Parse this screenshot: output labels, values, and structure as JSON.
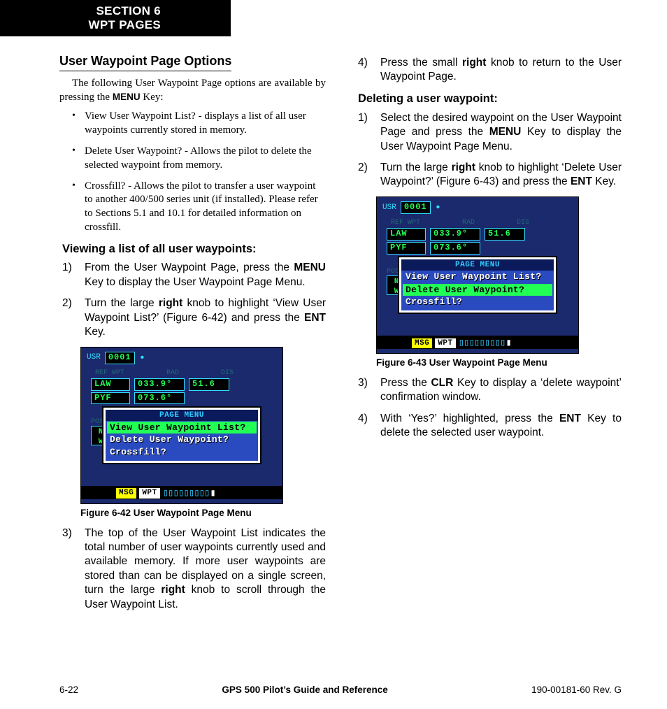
{
  "header": {
    "line1": "SECTION 6",
    "line2": "WPT PAGES"
  },
  "col1": {
    "title": "User Waypoint Page Options",
    "intro_pre": "The following User Waypoint Page options are available by pressing the ",
    "intro_key": "MENU",
    "intro_post": " Key:",
    "bullets": [
      "View User Waypoint List? - displays a list of all user waypoints currently stored in memory.",
      "Delete User Waypoint? - Allows the pilot to delete the selected waypoint from memory.",
      "Crossfill? - Allows the pilot to transfer a user waypoint to another 400/500 series unit (if installed).  Please refer to Sections 5.1 and 10.1 for detailed information on crossfill."
    ],
    "subhead1": "Viewing a list of all user waypoints:",
    "step1": {
      "num": "1)",
      "pre": "From the User Waypoint Page, press the ",
      "k1": "MENU",
      "post": " Key to display the User Waypoint Page Menu."
    },
    "step2": {
      "num": "2)",
      "pre": "Turn the large ",
      "k1": "right",
      "mid": " knob to highlight ‘View User Waypoint List?’ (Figure 6-42) and press the ",
      "k2": "ENT",
      "post": " Key."
    },
    "figcap": "Figure 6-42  User Waypoint Page Menu",
    "step3": {
      "num": "3)",
      "pre": "The top of the User Waypoint List indicates the total number of user waypoints currently used and available memory.  If more user waypoints are stored than can be displayed on a single screen, turn the large ",
      "k1": "right",
      "post": " knob to scroll through the User Waypoint List."
    }
  },
  "col2": {
    "step4": {
      "num": "4)",
      "pre": "Press the small ",
      "k1": "right",
      "post": " knob to return to the User Waypoint Page."
    },
    "subhead2": "Deleting a user waypoint:",
    "d1": {
      "num": "1)",
      "pre": "Select the desired waypoint on the User Waypoint Page and press the ",
      "k1": "MENU",
      "post": " Key to display the User Waypoint Page Menu."
    },
    "d2": {
      "num": "2)",
      "pre": "Turn the large ",
      "k1": "right",
      "mid": " knob to highlight ‘Delete User Waypoint?’ (Figure 6-43) and press the ",
      "k2": "ENT",
      "post": " Key."
    },
    "figcap": "Figure 6-43  User Waypoint Page Menu",
    "d3": {
      "num": "3)",
      "pre": "Press the ",
      "k1": "CLR",
      "post": " Key to display a ‘delete waypoint’ confirmation window."
    },
    "d4": {
      "num": "4)",
      "pre": "With ‘Yes?’ highlighted, press the ",
      "k1": "ENT",
      "post": " Key to delete the selected user waypoint."
    }
  },
  "gps1": {
    "usr": "USR",
    "id": "0001",
    "lbl_ref": "REF WPT",
    "lbl_rad": "RAD",
    "lbl_dis": "DIS",
    "r1c1": "LAW",
    "r1c2": "033.9°",
    "r1c3": "51.6",
    "r2c1": "PYF",
    "r2c2": "073.6°",
    "pos": "POS",
    "n": "N",
    "w": "W",
    "menu_title": "PAGE MENU",
    "m1": "View User Waypoint List?",
    "m2": "Delete User Waypoint?",
    "m3": "Crossfill?",
    "msg": "MSG",
    "wpt": "WPT",
    "bars": "▯▯▯▯▯▯▯▯▯"
  },
  "gps2": {
    "usr": "USR",
    "id": "0001",
    "lbl_ref": "REF WPT",
    "lbl_rad": "RAD",
    "lbl_dis": "DIS",
    "r1c1": "LAW",
    "r1c2": "033.9°",
    "r1c3": "51.6",
    "r2c1": "PYF",
    "r2c2": "073.6°",
    "pos": "POS",
    "n": "N",
    "w": "W",
    "menu_title": "PAGE MENU",
    "m1": "View User Waypoint List?",
    "m2": "Delete User Waypoint?",
    "m3": "Crossfill?",
    "msg": "MSG",
    "wpt": "WPT",
    "bars": "▯▯▯▯▯▯▯▯▯"
  },
  "footer": {
    "left": "6-22",
    "mid": "GPS 500 Pilot’s Guide and Reference",
    "right": "190-00181-60  Rev. G"
  }
}
